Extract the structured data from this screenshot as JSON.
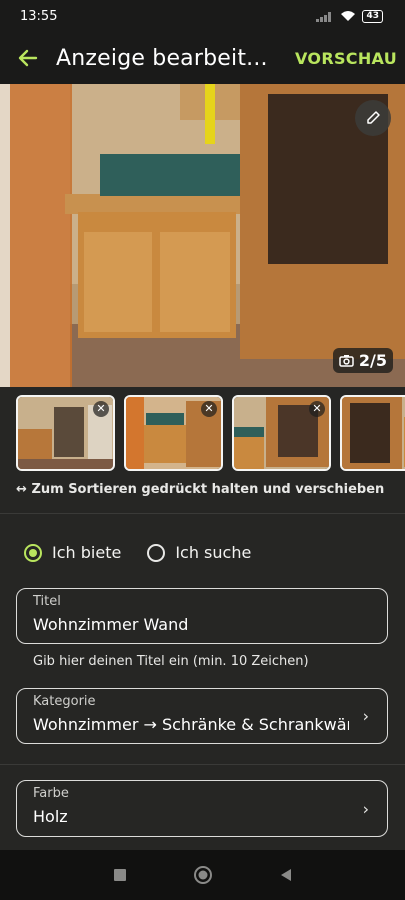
{
  "status_bar": {
    "time": "13:55",
    "battery": "43"
  },
  "app_bar": {
    "title": "Anzeige bearbeit...",
    "preview_label": "VORSCHAU"
  },
  "gallery": {
    "counter": "2/5",
    "thumbnails": [
      "photo-1",
      "photo-2",
      "photo-3",
      "photo-4"
    ],
    "remove_label": "✕"
  },
  "hint": {
    "arrow": "↔",
    "text": "Zum Sortieren gedrückt halten und verschieben"
  },
  "offer_type": {
    "options": [
      {
        "label": "Ich biete",
        "selected": true
      },
      {
        "label": "Ich suche",
        "selected": false
      }
    ]
  },
  "title_field": {
    "label": "Titel",
    "value": "Wohnzimmer Wand",
    "helper": "Gib hier deinen Titel ein (min. 10 Zeichen)"
  },
  "category_field": {
    "label": "Kategorie",
    "value": "Wohnzimmer → Schränke & Schrankwände"
  },
  "color_field": {
    "label": "Farbe",
    "value": "Holz"
  },
  "colors": {
    "accent": "#b9e55e",
    "background": "#262624",
    "bar": "#1a1a19"
  },
  "icons": {
    "back": "arrow-left-icon",
    "edit": "pencil-icon",
    "camera": "camera-icon",
    "chevron": "chevron-right-icon",
    "nav": [
      "square-icon",
      "circle-icon",
      "triangle-back-icon"
    ]
  }
}
